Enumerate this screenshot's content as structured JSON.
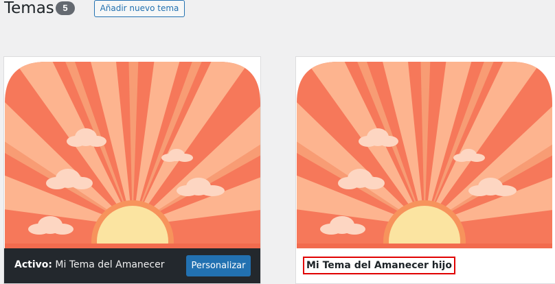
{
  "header": {
    "title": "Temas",
    "count": "5",
    "add_button_label": "Añadir nuevo tema"
  },
  "themes": [
    {
      "active_prefix": "Activo:",
      "name": "Mi Tema del Amanecer",
      "customize_label": "Personalizar",
      "active": true
    },
    {
      "name": "Mi Tema del Amanecer hijo",
      "active": false,
      "highlighted": true
    }
  ],
  "colors": {
    "sky_light": "#fdb48f",
    "sky_dark": "#f6785a",
    "sun": "#fbe4a1",
    "sun_ring": "#f7935c",
    "cloud": "#fdd6c2",
    "ground_stripe": "#f26b4e",
    "active_footer": "#23282d",
    "primary": "#2271b1",
    "highlight_border": "#e00000"
  },
  "icons": {
    "theme_screenshot": "sunrise-illustration"
  }
}
